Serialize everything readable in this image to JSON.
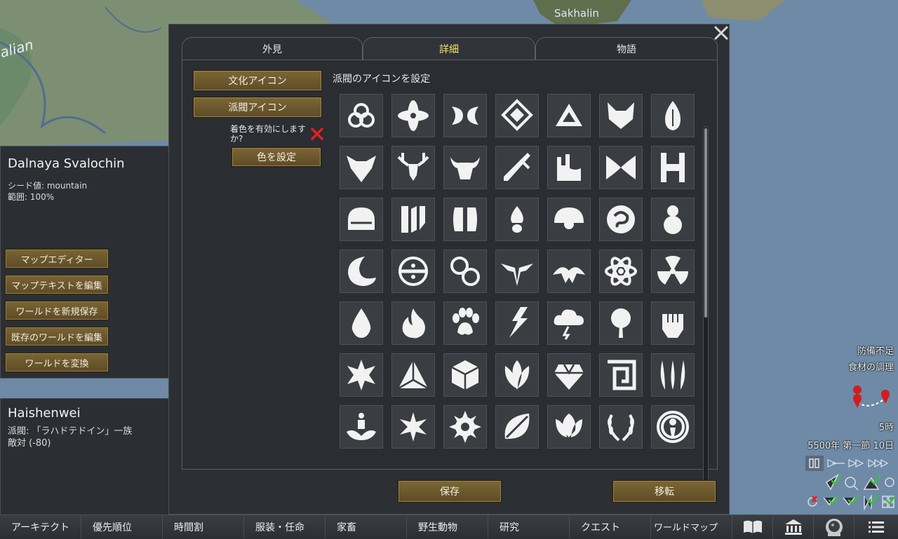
{
  "map": {
    "label": "Sakhalin",
    "edge_label": "alian"
  },
  "world_panel": {
    "title": "Dalnaya Svalochin",
    "seed_line": "シード値: mountain",
    "coverage_line": "範囲: 100%",
    "buttons": [
      "マップエディター",
      "マップテキストを編集",
      "ワールドを新規保存",
      "既存のワールドを編集",
      "ワールドを変換"
    ]
  },
  "faction_panel": {
    "title": "Haishenwei",
    "faction_line": "派閥: 「ラハドテドイン」一族",
    "hostility_line": "敵対 (-80)"
  },
  "dialog": {
    "tabs": [
      "外見",
      "詳細",
      "物語"
    ],
    "active_tab": "詳細",
    "culture_icon_button": "文化アイコン",
    "faction_icon_button": "派閥アイコン",
    "enable_color_label": "着色を有効にしますか?",
    "set_color_button": "色を設定",
    "icon_grid_label": "派閥のアイコンを設定",
    "icons": [
      [
        "triquetra-icon",
        "four-petal-cross-icon",
        "crescent-pair-icon",
        "diamond-chevron-icon",
        "triangle-icon",
        "fox-head-icon",
        "flame-crest-icon"
      ],
      [
        "wolf-head-icon",
        "stag-head-icon",
        "bull-head-icon",
        "blade-cross-icon",
        "castle-icon",
        "bowtie-icon",
        "twin-h-icon"
      ],
      [
        "dome-icon",
        "fractured-glyph-icon",
        "split-pill-icon",
        "mushroom-icon",
        "half-sun-icon",
        "swirl-orb-icon",
        "figure-orb-icon"
      ],
      [
        "crescent-moon-icon",
        "circle-bar-icon",
        "linked-rings-icon",
        "winged-emblem-icon",
        "eagle-icon",
        "atom-icon",
        "radiation-icon"
      ],
      [
        "water-drop-icon",
        "fire-icon",
        "paw-print-icon",
        "lightning-fist-icon",
        "storm-cloud-icon",
        "tree-burst-icon",
        "fist-icon"
      ],
      [
        "eight-point-star-icon",
        "tri-pyramid-icon",
        "cube-icon",
        "lotus-bud-icon",
        "gem-icon",
        "square-spiral-icon",
        "claw-marks-icon"
      ],
      [
        "meditating-lotus-icon",
        "flower-star-icon",
        "gear-sun-icon",
        "leaf-icon",
        "tulip-icon",
        "laurel-wreath-icon",
        "ringed-circle-icon"
      ]
    ],
    "save_button": "保存",
    "transfer_button": "移転"
  },
  "bottom_bar": {
    "tabs": [
      "アーキテクト",
      "優先順位",
      "時間割",
      "服装・任命",
      "家畜",
      "野生動物",
      "研究",
      "クエスト",
      "ワールドマップ"
    ],
    "icons": [
      "book-icon",
      "government-icon",
      "astronaut-icon",
      "menu-icon"
    ]
  },
  "hud": {
    "alerts": [
      "防備不足",
      "食材の調理"
    ],
    "time": "5時",
    "date": "5500年 第一節 10日"
  },
  "colors": {
    "accent_active_tab": "#f6e36a",
    "button_brown": "#6b5629",
    "close_x_red": "#e02020"
  }
}
